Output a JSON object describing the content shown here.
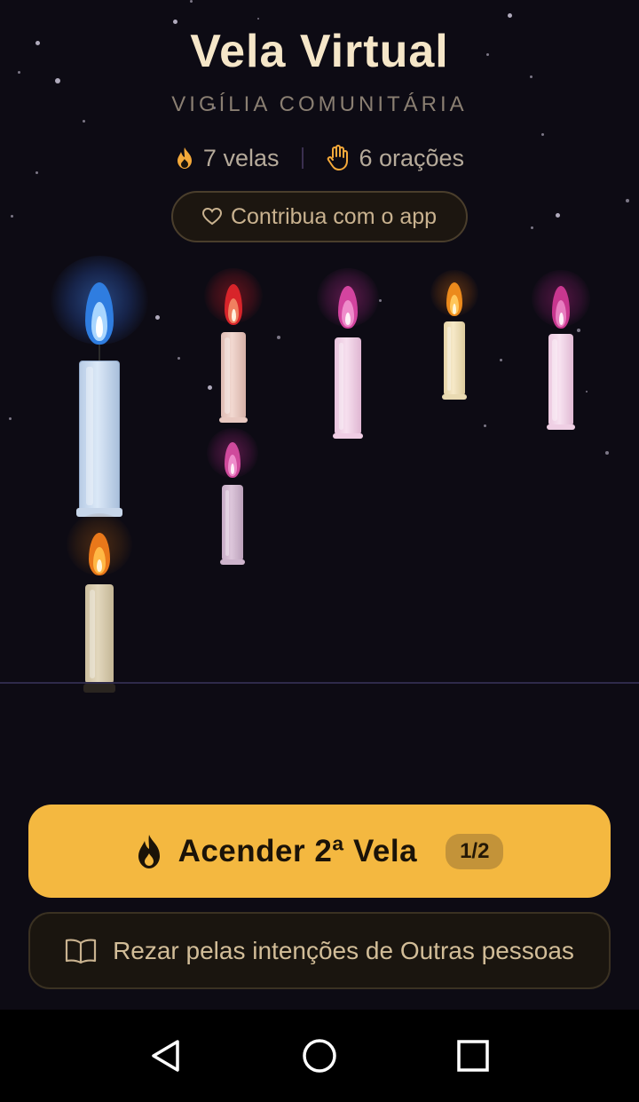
{
  "header": {
    "title": "Vela Virtual",
    "subtitle": "VIGÍLIA COMUNITÁRIA"
  },
  "stats": {
    "candles_label": "7 velas",
    "prayers_label": "6 orações",
    "candles_icon": "flame-icon",
    "prayers_icon": "hand-icon"
  },
  "contribute": {
    "label": "Contribua com o app",
    "icon": "heart-icon"
  },
  "candles": [
    {
      "color": "blue",
      "flame": "#5aa7f5"
    },
    {
      "color": "red",
      "flame": "#e0342a"
    },
    {
      "color": "magenta",
      "flame": "#d94fa5"
    },
    {
      "color": "orange",
      "flame": "#f39a20"
    },
    {
      "color": "magenta",
      "flame": "#c94a9a"
    },
    {
      "color": "magenta",
      "flame": "#d0509f"
    },
    {
      "color": "orange",
      "flame": "#f28a1c"
    }
  ],
  "primary_action": {
    "label": "Acender 2ª Vela",
    "counter": "1/2",
    "icon": "flame-icon",
    "color": "#f4b840"
  },
  "secondary_action": {
    "label": "Rezar pelas intenções de Outras pessoas",
    "icon": "book-icon"
  },
  "system_nav": {
    "back_icon": "back-triangle-icon",
    "home_icon": "home-circle-icon",
    "recents_icon": "recents-square-icon"
  }
}
